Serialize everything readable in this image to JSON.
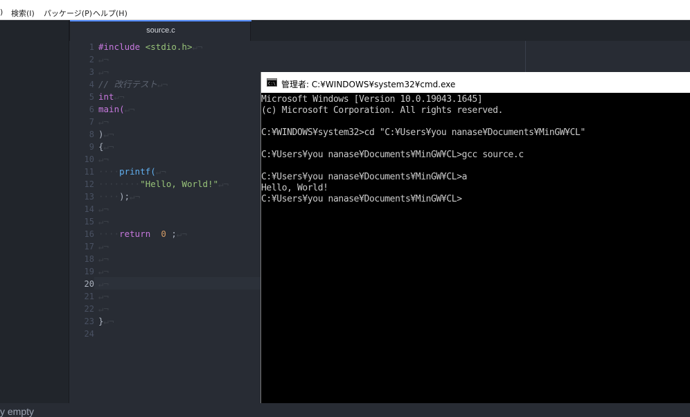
{
  "menu": {
    "items": [
      ")",
      "検索(I)",
      "パッケージ(P)",
      "ヘルプ(H)"
    ]
  },
  "left_panel": {
    "status_text": "y empty"
  },
  "editor": {
    "tab_title": "source.c",
    "active_line": 20,
    "line_numbers": [
      "1",
      "2",
      "3",
      "4",
      "5",
      "6",
      "7",
      "8",
      "9",
      "10",
      "11",
      "12",
      "13",
      "14",
      "15",
      "16",
      "17",
      "18",
      "19",
      "20",
      "21",
      "22",
      "23",
      "24"
    ],
    "eol_mark": "↵¬",
    "indent_mark": "····",
    "lines": {
      "l1_directive": "#include",
      "l1_header": "<stdio.h>",
      "l4_comment": "// 改行テスト",
      "l5_type": "int",
      "l6_func": "main(",
      "l8_paren": ")",
      "l9_brace": "{",
      "l11_call": "printf(",
      "l12_indent": "········",
      "l12_string": "\"Hello, World!\"",
      "l13_close": ");",
      "l16_return": "return",
      "l16_value": "0",
      "l16_semi": ";",
      "l23_brace": "}"
    }
  },
  "cmd": {
    "title": "管理者: C:¥WINDOWS¥system32¥cmd.exe",
    "lines": [
      "Microsoft Windows [Version 10.0.19043.1645]",
      "(c) Microsoft Corporation. All rights reserved.",
      "",
      "C:¥WINDOWS¥system32>cd \"C:¥Users¥you nanase¥Documents¥MinGW¥CL\"",
      "",
      "C:¥Users¥you nanase¥Documents¥MinGW¥CL>gcc source.c",
      "",
      "C:¥Users¥you nanase¥Documents¥MinGW¥CL>a",
      "Hello, World!",
      "C:¥Users¥you nanase¥Documents¥MinGW¥CL>"
    ]
  },
  "colors": {
    "editor_bg": "#282c34",
    "keyword": "#c678dd",
    "string": "#98c379",
    "number": "#d19a66",
    "function": "#61afef",
    "comment": "#5c6370",
    "terminal_bg": "#000000",
    "terminal_fg": "#cccccc"
  }
}
